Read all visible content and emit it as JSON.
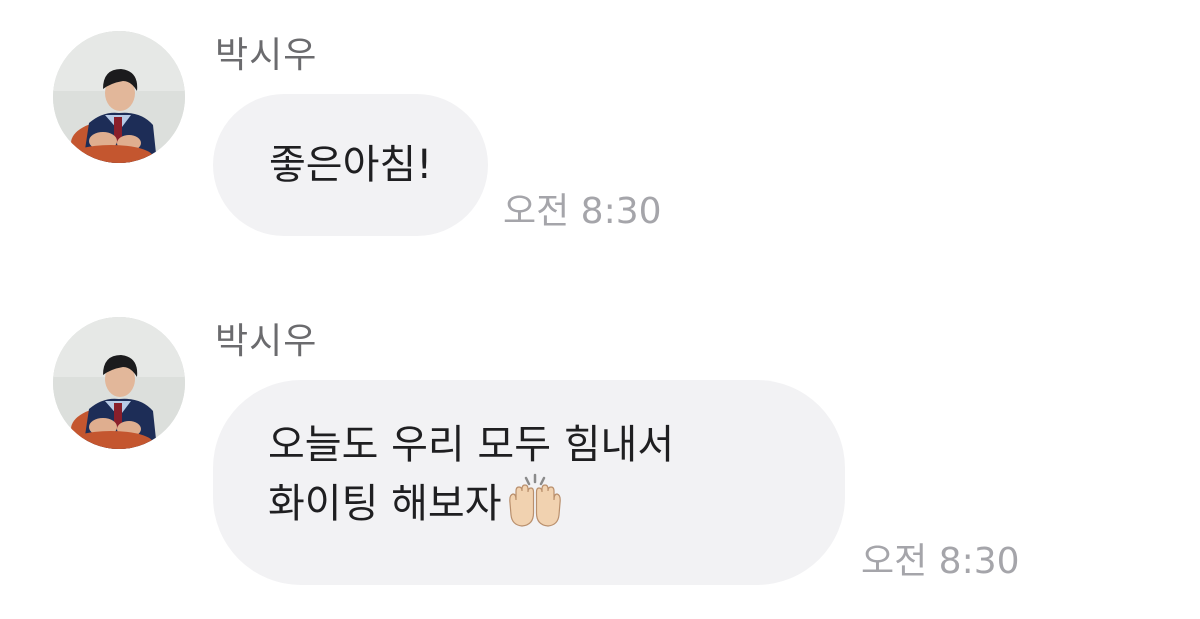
{
  "messages": [
    {
      "sender": "박시우",
      "lines": [
        "좋은아침!"
      ],
      "time": "오전 8:30"
    },
    {
      "sender": "박시우",
      "lines": [
        "오늘도 우리 모두 힘내서",
        "화이팅 해보자"
      ],
      "emoji": "raising-hands-emoji",
      "time": "오전 8:30"
    }
  ],
  "colors": {
    "background": "#ffffff",
    "bubble": "#f2f2f4",
    "sender_text": "#6b6b6e",
    "time_text": "#a5a5aa",
    "message_text": "#1f1f21"
  }
}
